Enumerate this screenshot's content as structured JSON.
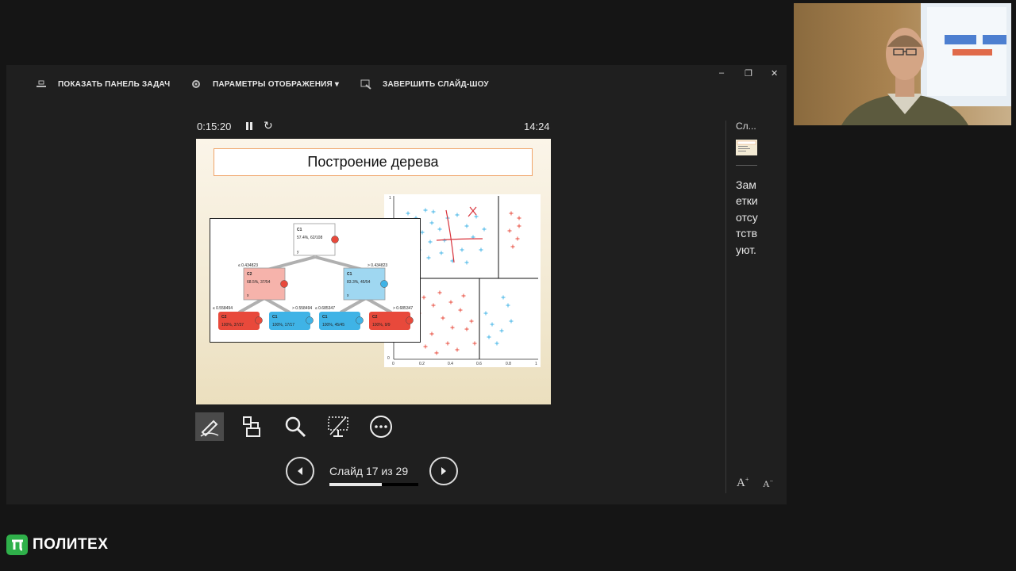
{
  "toolbar": {
    "show_taskbar": "ПОКАЗАТЬ ПАНЕЛЬ ЗАДАЧ",
    "display_settings": "ПАРАМЕТРЫ ОТОБРАЖЕНИЯ ▾",
    "end_slideshow": "ЗАВЕРШИТЬ СЛАЙД-ШОУ"
  },
  "timer": {
    "elapsed": "0:15:20",
    "clock": "14:24"
  },
  "slide": {
    "title": "Построение дерева",
    "tree": {
      "root": {
        "label": "C1",
        "stat": "57.4%, 62/108",
        "sub": "y"
      },
      "split_left": "≤ 0.434823",
      "split_right": "> 0.434823",
      "left": {
        "label": "C2",
        "stat": "68.5%, 37/54",
        "sub": "x"
      },
      "right": {
        "label": "C1",
        "stat": "83.3%, 45/54",
        "sub": "x"
      },
      "split_ll": "≤ 0.558494",
      "split_lr": "> 0.558494",
      "split_rl": "≤ 0.685347",
      "split_rr": "> 0.685347",
      "leaves": [
        {
          "label": "C2",
          "stat": "100%, 37/37"
        },
        {
          "label": "C1",
          "stat": "100%, 17/17"
        },
        {
          "label": "C1",
          "stat": "100%, 45/45"
        },
        {
          "label": "C2",
          "stat": "100%, 9/9"
        }
      ]
    },
    "scatter": {
      "x_ticks": [
        "0",
        "0.2",
        "0.4",
        "0.6",
        "0.8",
        "1"
      ],
      "y_ticks": [
        "0",
        "1"
      ]
    }
  },
  "navigation": {
    "counter": "Слайд 17 из 29",
    "progress": 0.586
  },
  "side": {
    "next_label": "Сл...",
    "notes": "Заметки отсутствуют."
  },
  "logo": {
    "text": "ПОЛИТЕХ"
  },
  "colors": {
    "red": "#e8493b",
    "blue": "#3fb3e6",
    "green": "#2fb04a"
  }
}
